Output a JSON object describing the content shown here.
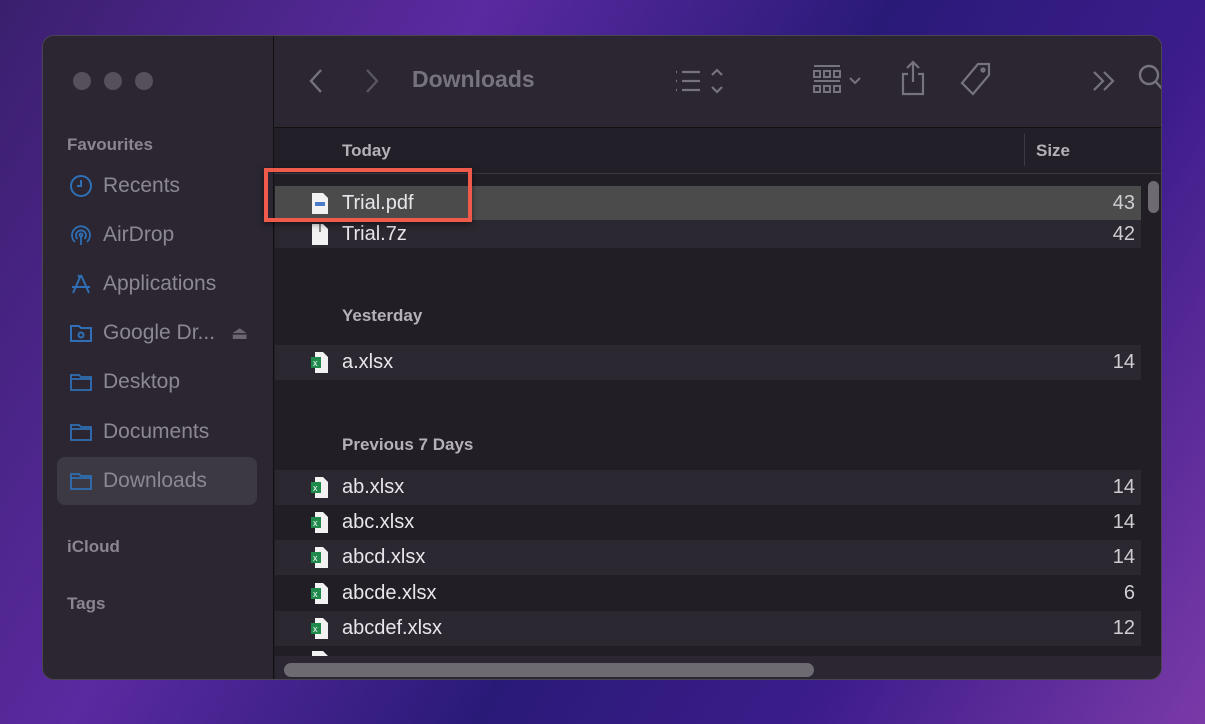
{
  "window": {
    "title": "Downloads"
  },
  "sidebar": {
    "favourites_label": "Favourites",
    "items": [
      {
        "label": "Recents",
        "icon": "clock-icon"
      },
      {
        "label": "AirDrop",
        "icon": "airdrop-icon"
      },
      {
        "label": "Applications",
        "icon": "applications-icon"
      },
      {
        "label": "Google Dr...",
        "icon": "folder-cloud-icon"
      },
      {
        "label": "Desktop",
        "icon": "folder-icon"
      },
      {
        "label": "Documents",
        "icon": "folder-icon"
      },
      {
        "label": "Downloads",
        "icon": "folder-icon",
        "selected": true
      }
    ],
    "icloud_label": "iCloud",
    "tags_label": "Tags"
  },
  "columns": {
    "name": "Today",
    "size": "Size"
  },
  "groups": [
    {
      "label": "Today",
      "files": [
        {
          "name": "Trial.pdf",
          "size": "43",
          "selected": true,
          "highlighted": true
        },
        {
          "name": "Trial.7z",
          "size": "42"
        }
      ]
    },
    {
      "label": "Yesterday",
      "files": [
        {
          "name": "a.xlsx",
          "size": "14"
        }
      ]
    },
    {
      "label": "Previous 7 Days",
      "files": [
        {
          "name": "ab.xlsx",
          "size": "14"
        },
        {
          "name": "abc.xlsx",
          "size": "14"
        },
        {
          "name": "abcd.xlsx",
          "size": "14"
        },
        {
          "name": "abcde.xlsx",
          "size": "6"
        },
        {
          "name": "abcdef.xlsx",
          "size": "12"
        }
      ]
    }
  ],
  "colors": {
    "highlight_box": "#f05a4a",
    "selection": "#4b4b4b",
    "accent_icon": "#2f6fb5"
  }
}
